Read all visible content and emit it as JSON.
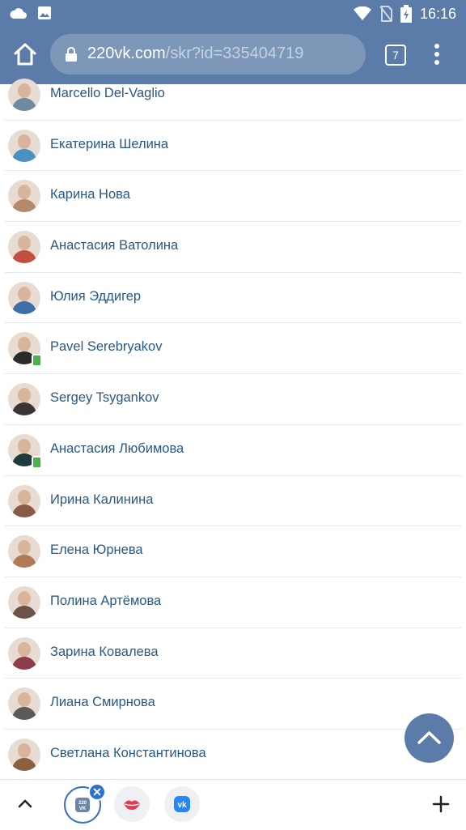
{
  "status_bar": {
    "time": "16:16"
  },
  "browser": {
    "url_host": "220vk.com",
    "url_path": "/skr?id=335404719",
    "tab_count": "7"
  },
  "friends": [
    {
      "name": "Marcello Del-Vaglio",
      "avatar_color": "#6d8aa0",
      "mobile": false
    },
    {
      "name": "Екатерина Шелина",
      "avatar_color": "#4a90c0",
      "mobile": false
    },
    {
      "name": "Карина Нова",
      "avatar_color": "#b58a6a",
      "mobile": false
    },
    {
      "name": "Анастасия Ватолина",
      "avatar_color": "#c25040",
      "mobile": false
    },
    {
      "name": "Юлия Эддигер",
      "avatar_color": "#3c6fa8",
      "mobile": false
    },
    {
      "name": "Pavel Serebryakov",
      "avatar_color": "#2a2a2a",
      "mobile": true
    },
    {
      "name": "Sergey Tsygankov",
      "avatar_color": "#3a3434",
      "mobile": false
    },
    {
      "name": "Анастасия Любимова",
      "avatar_color": "#1e3a3a",
      "mobile": true
    },
    {
      "name": "Ирина Калинина",
      "avatar_color": "#8a5a48",
      "mobile": false
    },
    {
      "name": "Елена Юрнева",
      "avatar_color": "#b07a58",
      "mobile": false
    },
    {
      "name": "Полина Артёмова",
      "avatar_color": "#6c5348",
      "mobile": false
    },
    {
      "name": "Зарина Ковалева",
      "avatar_color": "#8c3c4a",
      "mobile": false
    },
    {
      "name": "Лиана Смирнова",
      "avatar_color": "#5a5a5a",
      "mobile": false
    },
    {
      "name": "Светлана Константинова",
      "avatar_color": "#8a6040",
      "mobile": false
    }
  ],
  "bottom_tabs": [
    {
      "icon": "220vk-icon",
      "text": "220\nVK",
      "active": true
    },
    {
      "icon": "lips-icon",
      "active": false
    },
    {
      "icon": "vk-icon",
      "text": "vk",
      "active": false
    }
  ],
  "colors": {
    "header": "#5b7ca8",
    "link": "#2a5885",
    "online_mobile": "#4bb34b",
    "active_tab": "#3a6fc2",
    "close_badge": "#2b73d2"
  }
}
